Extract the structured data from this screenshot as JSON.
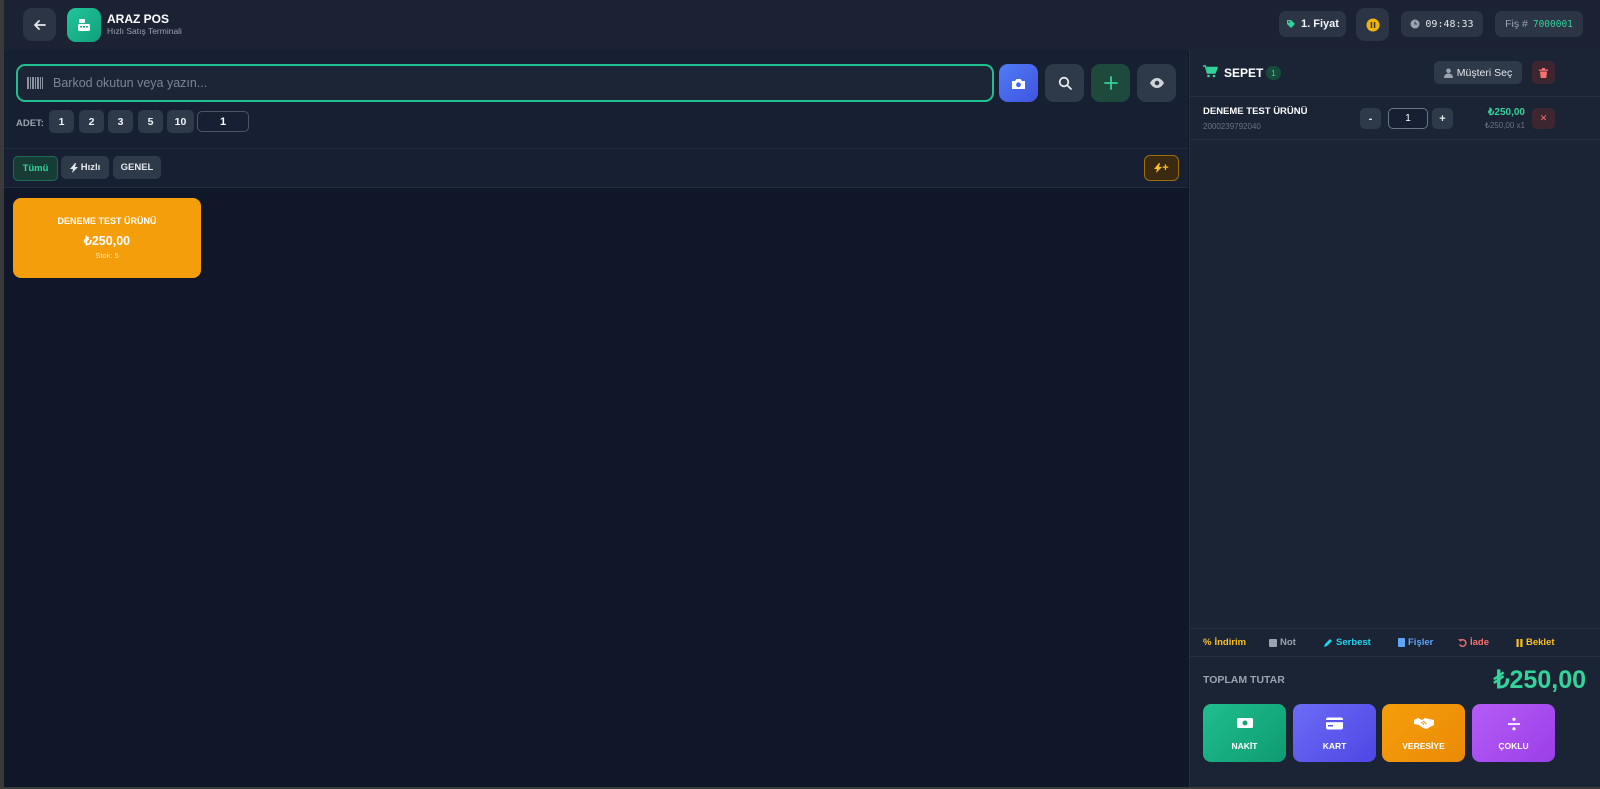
{
  "header": {
    "app_name": "ARAZ POS",
    "app_subtitle": "Hızlı Satış Terminali",
    "price_level": "1. Fiyat",
    "clock": "09:48:33",
    "receipt_label": "Fiş #",
    "receipt_no": "7000001"
  },
  "search": {
    "placeholder": "Barkod okutun veya yazın...",
    "value": ""
  },
  "quantity": {
    "label": "ADET:",
    "presets": [
      "1",
      "2",
      "3",
      "5",
      "10"
    ],
    "value": "1"
  },
  "categories": {
    "all": "Tümü",
    "fast": "Hızlı",
    "genel": "GENEL",
    "quick_add": "+"
  },
  "products": [
    {
      "name": "DENEME TEST ÜRÜNÜ",
      "price": "₺250,00",
      "stock": "Stok: 5",
      "color": "#f59e0b"
    }
  ],
  "cart": {
    "title": "SEPET",
    "count": "1",
    "customer_button": "Müşteri Seç",
    "items": [
      {
        "name": "DENEME TEST ÜRÜNÜ",
        "barcode": "2000239792040",
        "qty": "1",
        "total": "₺250,00",
        "unit": "₺250,00 x1",
        "minus": "-",
        "plus": "+",
        "remove": "✕"
      }
    ],
    "actions": {
      "discount": "İndirim",
      "note": "Not",
      "free": "Serbest",
      "receipts": "Fişler",
      "refund": "İade",
      "hold": "Beklet"
    },
    "total_label": "TOPLAM TUTAR",
    "total_value": "₺250,00"
  },
  "payments": {
    "cash": "NAKİT",
    "card": "KART",
    "credit": "VERESİYE",
    "multi": "ÇOKLU"
  },
  "colors": {
    "accent": "#1fbf8f",
    "product_card": "#f59e0b",
    "cash": "#1fbf8f",
    "card": "#5b5bf0",
    "credit": "#f59e0b",
    "multi": "#a84ef0"
  }
}
